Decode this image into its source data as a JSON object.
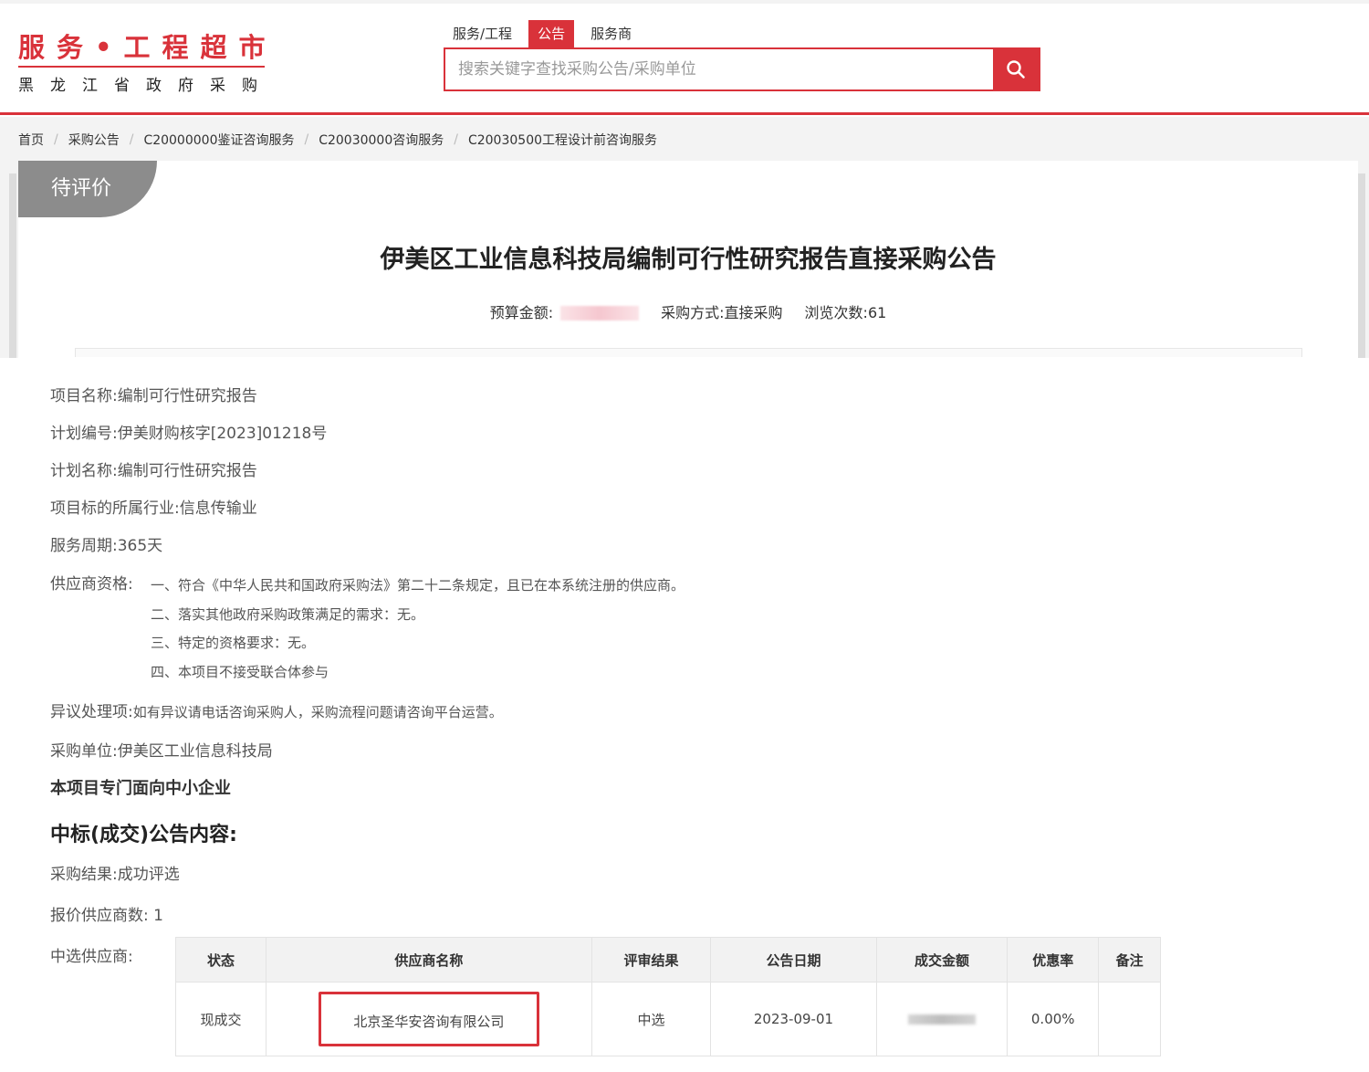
{
  "header": {
    "logo_top": "服务•工程超市",
    "logo_bottom": "黑龙江省政府采购",
    "search_tabs": [
      "服务/工程",
      "公告",
      "服务商"
    ],
    "active_tab": "公告",
    "search_placeholder": "搜索关键字查找采购公告/采购单位",
    "accent_color": "#d9323a"
  },
  "breadcrumb": [
    "首页",
    "采购公告",
    "C20000000鉴证咨询服务",
    "C20030000咨询服务",
    "C20030500工程设计前咨询服务"
  ],
  "notice": {
    "status": "待评价",
    "title": "伊美区工业信息科技局编制可行性研究报告直接采购公告",
    "budget_label": "预算金额:",
    "method_label": "采购方式:",
    "method_value": "直接采购",
    "views_label": "浏览次数:",
    "views_value": "61"
  },
  "details": {
    "project_name_label": "项目名称:",
    "project_name": "编制可行性研究报告",
    "plan_no_label": "计划编号:",
    "plan_no": "伊美财购核字[2023]01218号",
    "plan_name_label": "计划名称:",
    "plan_name": "编制可行性研究报告",
    "industry_label": "项目标的所属行业:",
    "industry": "信息传输业",
    "period_label": "服务周期:",
    "period": "365天",
    "qualification_label": "供应商资格:",
    "qualifications": [
      "一、符合《中华人民共和国政府采购法》第二十二条规定，且已在本系统注册的供应商。",
      "二、落实其他政府采购政策满足的需求：无。",
      "三、特定的资格要求：无。",
      "四、本项目不接受联合体参与"
    ],
    "objection_label": "异议处理项:",
    "objection": "如有异议请电话咨询采购人，采购流程问题请咨询平台运营。",
    "purchaser_label": "采购单位:",
    "purchaser": "伊美区工业信息科技局",
    "sme_note": "本项目专门面向中小企业"
  },
  "result": {
    "heading": "中标(成交)公告内容:",
    "result_label": "采购结果:",
    "result_value": "成功评选",
    "bidder_count_label": "报价供应商数:",
    "bidder_count": "1",
    "winner_label": "中选供应商:",
    "table_headers": [
      "状态",
      "供应商名称",
      "评审结果",
      "公告日期",
      "成交金额",
      "优惠率",
      "备注"
    ],
    "rows": [
      {
        "status": "现成交",
        "supplier": "北京圣华安咨询有限公司",
        "review": "中选",
        "date": "2023-09-01",
        "amount": "",
        "discount": "0.00%",
        "remark": ""
      }
    ]
  }
}
